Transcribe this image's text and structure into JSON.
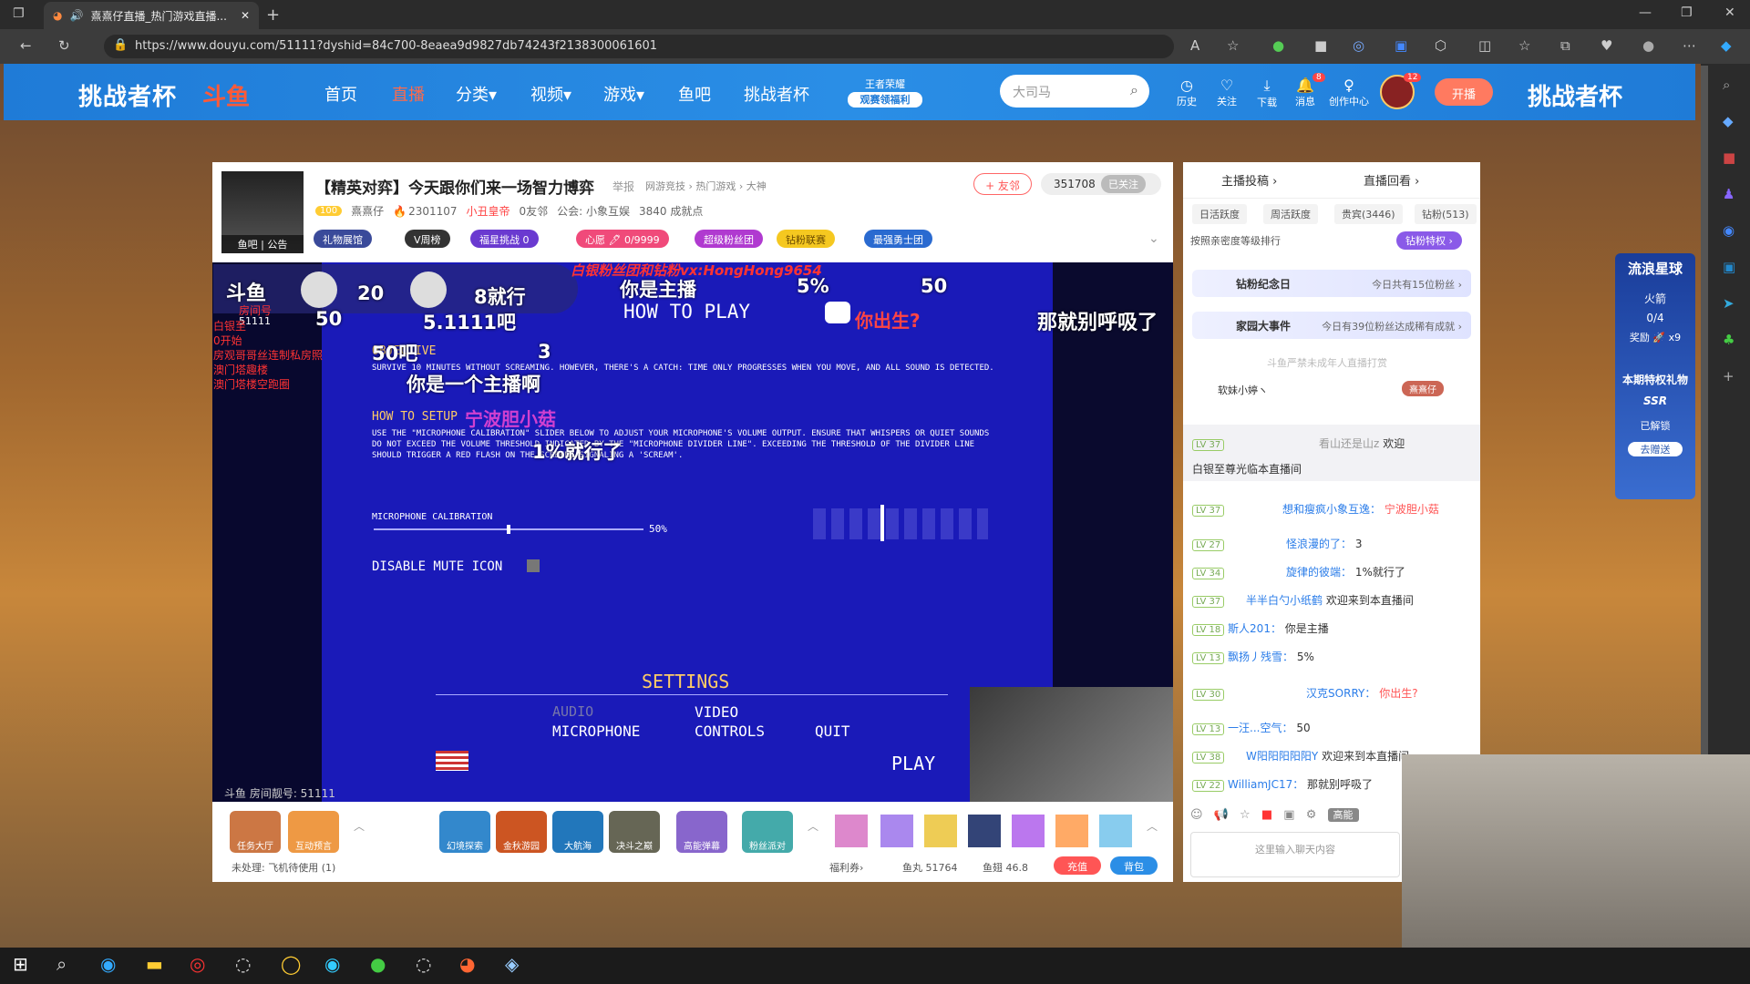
{
  "browser": {
    "tab_title": "熹熹仔直播_热门游戏直播...",
    "url": "https://www.douyu.com/51111?dyshid=84c700-8eaea9d9827db74243f2138300061601"
  },
  "nav": {
    "cup_left": "挑战者杯",
    "cup_right": "挑战者杯",
    "logo": "斗鱼",
    "items": [
      "首页",
      "直播",
      "分类▾",
      "视频▾",
      "游戏▾",
      "鱼吧",
      "挑战者杯"
    ],
    "badge_line1": "王者荣耀",
    "badge_line2": "观赛领福利",
    "search_placeholder": "大司马",
    "tools": [
      "历史",
      "关注",
      "下载",
      "消息",
      "创作中心"
    ],
    "message_count": "8",
    "avatar_count": "12",
    "open_label": "开播"
  },
  "room": {
    "title": "【精英对弈】今天跟你们来一场智力博弈",
    "report": "举报",
    "category": "网游竞技 › 热门游戏 › 大神",
    "level": "100",
    "streamer": "熹熹仔",
    "hot": "2301107",
    "badge": "小丑皇帝",
    "friend": "0友邻",
    "union": "公会: 小象互娱",
    "achievement": "3840 成就点",
    "avatar_caption": "鱼吧 | 公告",
    "follow": "+ 友邻",
    "fans_count": "351708",
    "followed": "已关注",
    "pills": [
      "礼物展馆",
      "V周榜",
      "福星挑战 0",
      "心愿 🖊 0/9999",
      "超级粉丝团",
      "钻粉联赛",
      "最强勇士团"
    ],
    "room_number": "斗鱼 房间靓号: 51111"
  },
  "video": {
    "overlay_logo": "斗鱼",
    "overlay_room": "房间号",
    "overlay_room_num": "51111",
    "overlay_score1": "20",
    "overlay_score2": "8就行",
    "overlay_50a": "50",
    "overlay_big": "5.1111吧",
    "overlay_zhubo": "你是主播",
    "overlay_5pct": "5%",
    "overlay_50b": "50",
    "overlay_qq": "白银粉丝团和钻粉vx:HongHong9654",
    "overlay_ni": "你出生?",
    "overlay_right": "那就别呼吸了",
    "overlay_red": [
      "白银至",
      "0开始",
      "房观哥哥丝连制私房照",
      "澳门塔趣楼",
      "澳门塔楼空跑圈"
    ],
    "overlay_50ba": "50吧",
    "overlay_3": "3",
    "overlay_yige": "你是一个主播啊",
    "overlay_ningbo": "宁波胆小菇",
    "overlay_1pct": "1%就行了",
    "how_to_play": "HOW TO PLAY",
    "objective_label": "OBJECTIVE",
    "objective_text": "SURVIVE 10 MINUTES WITHOUT SCREAMING. HOWEVER, THERE'S A CATCH: TIME ONLY PROGRESSES WHEN YOU MOVE, AND ALL SOUND IS DETECTED.",
    "how_to_setup": "HOW TO SETUP",
    "setup_text": "USE THE \"MICROPHONE CALIBRATION\" SLIDER BELOW TO ADJUST YOUR MICROPHONE'S VOLUME OUTPUT. ENSURE THAT WHISPERS OR QUIET SOUNDS DO NOT EXCEED THE VOLUME THRESHOLD INDICATED BY THE \"MICROPHONE DIVIDER LINE\". EXCEEDING THE THRESHOLD OF THE DIVIDER LINE SHOULD TRIGGER A RED FLASH ON THE SCREEN, SIGNALING A 'SCREAM'.",
    "mic_label": "MICROPHONE CALIBRATION",
    "mic_value": "50%",
    "mic_level": 0.5,
    "mute_label": "DISABLE MUTE ICON",
    "settings": "SETTINGS",
    "audio": "AUDIO",
    "microphone": "MICROPHONE",
    "video_l": "VIDEO",
    "controls": "CONTROLS",
    "quit": "QUIT",
    "play": "PLAY"
  },
  "toolbar": {
    "items": [
      "任务大厅",
      "互动预言",
      "幻境探索",
      "金秋游园",
      "大航海",
      "决斗之巅",
      "高能弹幕",
      "粉丝派对"
    ],
    "pending": "未处理: 飞机待使用 (1)",
    "welfare": "福利券›",
    "fishball": "鱼丸 51764",
    "fishfin": "鱼翅 46.8",
    "recharge": "充值",
    "backpack": "背包"
  },
  "right": {
    "tab1": "主播投稿 ›",
    "tab2": "直播回看 ›",
    "subtabs": [
      "日活跃度",
      "周活跃度",
      "贵宾(3446)",
      "钻粉(513)"
    ],
    "rank_label": "按照亲密度等级排行",
    "rank_btn": "钻粉特权 ›",
    "banner1": "钻粉纪念日",
    "banner1_side": "今日共有15位粉丝 ›",
    "banner2": "家园大事件",
    "banner2_side": "今日有39位粉丝达成稀有成就 ›",
    "notice": "斗鱼严禁未成年人直播打赏",
    "top_fan": "软妹小婷ヽ",
    "top_fan_badge": "熹熹仔",
    "chat": [
      {
        "lv": "LV 37",
        "name": "看山还是山z",
        "msg": "欢迎",
        "extra": "白银至尊光临本直播间"
      },
      {
        "lv": "LV 37",
        "name": "想和瘦疯小象互逸：",
        "msg": "宁波胆小菇"
      },
      {
        "lv": "LV 27",
        "name": "怪浪漫的了：",
        "msg": "3"
      },
      {
        "lv": "LV 34",
        "name": "旋律的彼端：",
        "msg": "1%就行了"
      },
      {
        "lv": "LV 37",
        "name": "半半白勺小纸鹤",
        "msg": "欢迎来到本直播间"
      },
      {
        "lv": "LV 18",
        "name": "斯人201：",
        "msg": "你是主播"
      },
      {
        "lv": "LV 13",
        "name": "飘扬丿残雪：",
        "msg": "5%"
      },
      {
        "lv": "LV 30",
        "name": "汉克SORRY：",
        "msg": "你出生?"
      },
      {
        "lv": "LV 13",
        "name": "一汪...空气：",
        "msg": "50"
      },
      {
        "lv": "LV 38",
        "name": "W阳阳阳阳阳Y",
        "msg": "欢迎来到本直播间"
      },
      {
        "lv": "LV 22",
        "name": "WilliamJC17：",
        "msg": "那就别呼吸了"
      }
    ],
    "input_placeholder": "这里输入聊天内容",
    "high_energy": "高能"
  },
  "promo": {
    "title": "流浪星球",
    "fire": "火箭",
    "progress": "0/4",
    "reward": "奖励 🚀 x9",
    "title2": "本期特权礼物",
    "ssr": "SSR",
    "unlocked": "已解锁",
    "send": "去赠送"
  },
  "colors": {
    "brand": "#1f7bd7",
    "accent": "#ff5a38",
    "video_bg": "#1a1ab8"
  }
}
